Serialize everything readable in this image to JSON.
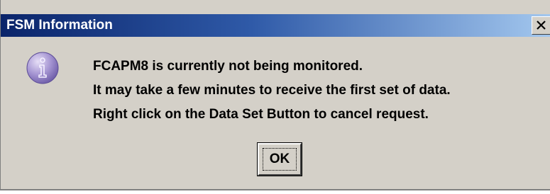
{
  "window": {
    "title": "FSM Information",
    "close_icon": "close-icon"
  },
  "dialog": {
    "icon": "information-icon",
    "message_lines": [
      "FCAPM8 is currently not being monitored.",
      "It may take a few minutes to receive the first set of data.",
      "Right click on the Data Set Button to cancel request."
    ],
    "ok_label": "OK"
  },
  "colors": {
    "titlebar_start": "#0a246a",
    "titlebar_end": "#a6caf0",
    "dialog_background": "#d4d0c8",
    "icon_fill": "#9c8cc8"
  }
}
